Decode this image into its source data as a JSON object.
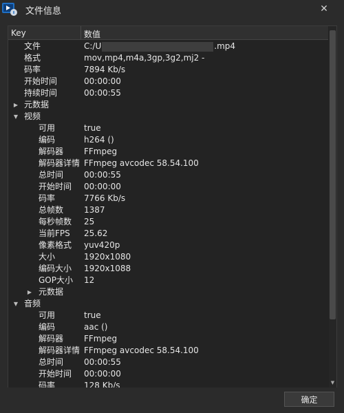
{
  "window": {
    "title": "文件信息",
    "close_icon": "close-icon"
  },
  "table": {
    "col_key": "Key",
    "col_value": "数值",
    "rows": [
      {
        "level": 1,
        "arrow": "",
        "key": "文件",
        "value_prefix": "C:/U",
        "value_suffix": ".mp4",
        "redacted": true
      },
      {
        "level": 1,
        "arrow": "",
        "key": "格式",
        "value": "mov,mp4,m4a,3gp,3g2,mj2 -"
      },
      {
        "level": 1,
        "arrow": "",
        "key": "码率",
        "value": "7894 Kb/s"
      },
      {
        "level": 1,
        "arrow": "",
        "key": "开始时间",
        "value": "00:00:00"
      },
      {
        "level": 1,
        "arrow": "",
        "key": "持续时间",
        "value": "00:00:55"
      },
      {
        "level": 0,
        "arrow": "right",
        "key": "元数据",
        "value": ""
      },
      {
        "level": 0,
        "arrow": "down",
        "key": "视频",
        "value": ""
      },
      {
        "level": 2,
        "arrow": "",
        "key": "可用",
        "value": "true"
      },
      {
        "level": 2,
        "arrow": "",
        "key": "编码",
        "value": "h264 ()"
      },
      {
        "level": 2,
        "arrow": "",
        "key": "解码器",
        "value": "FFmpeg"
      },
      {
        "level": 2,
        "arrow": "",
        "key": "解码器详情",
        "value": "FFmpeg avcodec 58.54.100"
      },
      {
        "level": 2,
        "arrow": "",
        "key": "总时间",
        "value": "00:00:55"
      },
      {
        "level": 2,
        "arrow": "",
        "key": "开始时间",
        "value": "00:00:00"
      },
      {
        "level": 2,
        "arrow": "",
        "key": "码率",
        "value": "7766 Kb/s"
      },
      {
        "level": 2,
        "arrow": "",
        "key": "总帧数",
        "value": "1387"
      },
      {
        "level": 2,
        "arrow": "",
        "key": "每秒帧数",
        "value": "25"
      },
      {
        "level": 2,
        "arrow": "",
        "key": "当前FPS",
        "value": "25.62"
      },
      {
        "level": 2,
        "arrow": "",
        "key": "像素格式",
        "value": "yuv420p"
      },
      {
        "level": 2,
        "arrow": "",
        "key": "大小",
        "value": "1920x1080"
      },
      {
        "level": 2,
        "arrow": "",
        "key": "编码大小",
        "value": "1920x1088"
      },
      {
        "level": 2,
        "arrow": "",
        "key": "GOP大小",
        "value": "12"
      },
      {
        "level": 1.5,
        "arrow": "right",
        "key": "元数据",
        "value": ""
      },
      {
        "level": 0,
        "arrow": "down",
        "key": "音频",
        "value": ""
      },
      {
        "level": 2,
        "arrow": "",
        "key": "可用",
        "value": "true"
      },
      {
        "level": 2,
        "arrow": "",
        "key": "编码",
        "value": "aac ()"
      },
      {
        "level": 2,
        "arrow": "",
        "key": "解码器",
        "value": "FFmpeg"
      },
      {
        "level": 2,
        "arrow": "",
        "key": "解码器详情",
        "value": "FFmpeg avcodec 58.54.100"
      },
      {
        "level": 2,
        "arrow": "",
        "key": "总时间",
        "value": "00:00:55"
      },
      {
        "level": 2,
        "arrow": "",
        "key": "开始时间",
        "value": "00:00:00"
      },
      {
        "level": 2,
        "arrow": "",
        "key": "码率",
        "value": "128 Kb/s"
      }
    ]
  },
  "footer": {
    "ok_label": "确定"
  }
}
